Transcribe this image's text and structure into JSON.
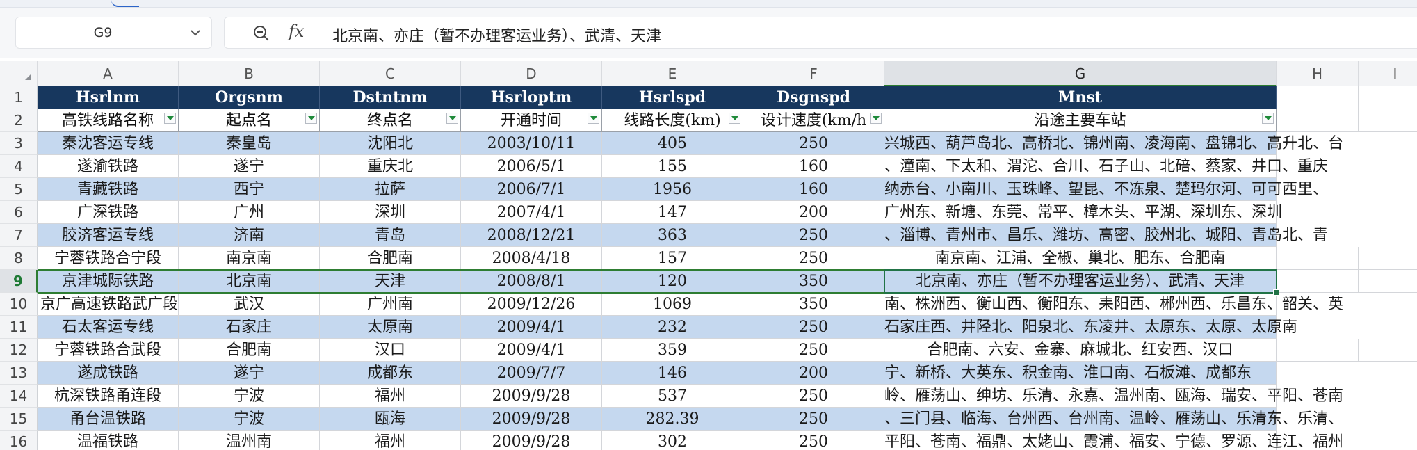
{
  "name_box": {
    "value": "G9"
  },
  "formula_bar": {
    "fx_label": "fx",
    "content": "北京南、亦庄（暂不办理客运业务）、武清、天津"
  },
  "columns": [
    "A",
    "B",
    "C",
    "D",
    "E",
    "F",
    "G",
    "H",
    "I"
  ],
  "selected_column": "G",
  "selected_row": "9",
  "header_row_1": [
    "Hsrlnm",
    "Orgsnm",
    "Dstntnm",
    "Hsrloptm",
    "Hsrlspd",
    "Dsgnspd",
    "Mnst"
  ],
  "header_row_2": [
    "高铁线路名称",
    "起点名",
    "终点名",
    "开通时间",
    "线路长度(km)",
    "设计速度(km/h",
    "沿途主要车站"
  ],
  "rows": [
    {
      "row": "3",
      "line": "秦沈客运专线",
      "start": "秦皇岛",
      "end": "沈阳北",
      "open": "2003/10/11",
      "length": "405",
      "speed": "250",
      "stations": "兴城西、葫芦岛北、高桥北、锦州南、凌海南、盘锦北、高升北、台"
    },
    {
      "row": "4",
      "line": "遂渝铁路",
      "start": "遂宁",
      "end": "重庆北",
      "open": "2006/5/1",
      "length": "155",
      "speed": "160",
      "stations": "、潼南、下太和、渭沱、合川、石子山、北碚、蔡家、井口、重庆"
    },
    {
      "row": "5",
      "line": "青藏铁路",
      "start": "西宁",
      "end": "拉萨",
      "open": "2006/7/1",
      "length": "1956",
      "speed": "160",
      "stations": "纳赤台、小南川、玉珠峰、望昆、不冻泉、楚玛尔河、可可西里、"
    },
    {
      "row": "6",
      "line": "广深铁路",
      "start": "广州",
      "end": "深圳",
      "open": "2007/4/1",
      "length": "147",
      "speed": "200",
      "stations": "广州东、新塘、东莞、常平、樟木头、平湖、深圳东、深圳"
    },
    {
      "row": "7",
      "line": "胶济客运专线",
      "start": "济南",
      "end": "青岛",
      "open": "2008/12/21",
      "length": "363",
      "speed": "250",
      "stations": "、淄博、青州市、昌乐、潍坊、高密、胶州北、城阳、青岛北、青"
    },
    {
      "row": "8",
      "line": "宁蓉铁路合宁段",
      "start": "南京南",
      "end": "合肥南",
      "open": "2008/4/18",
      "length": "157",
      "speed": "250",
      "stations": "南京南、江浦、全椒、巢北、肥东、合肥南"
    },
    {
      "row": "9",
      "line": "京津城际铁路",
      "start": "北京南",
      "end": "天津",
      "open": "2008/8/1",
      "length": "120",
      "speed": "350",
      "stations": "北京南、亦庄（暂不办理客运业务）、武清、天津"
    },
    {
      "row": "10",
      "line": "京广高速铁路武广段",
      "start": "武汉",
      "end": "广州南",
      "open": "2009/12/26",
      "length": "1069",
      "speed": "350",
      "stations": "南、株洲西、衡山西、衡阳东、耒阳西、郴州西、乐昌东、韶关、英"
    },
    {
      "row": "11",
      "line": "石太客运专线",
      "start": "石家庄",
      "end": "太原南",
      "open": "2009/4/1",
      "length": "232",
      "speed": "250",
      "stations": "石家庄西、井陉北、阳泉北、东凌井、太原东、太原、太原南"
    },
    {
      "row": "12",
      "line": "宁蓉铁路合武段",
      "start": "合肥南",
      "end": "汉口",
      "open": "2009/4/1",
      "length": "359",
      "speed": "250",
      "stations": "合肥南、六安、金寨、麻城北、红安西、汉口"
    },
    {
      "row": "13",
      "line": "遂成铁路",
      "start": "遂宁",
      "end": "成都东",
      "open": "2009/7/7",
      "length": "146",
      "speed": "200",
      "stations": "宁、新桥、大英东、积金南、淮口南、石板滩、成都东"
    },
    {
      "row": "14",
      "line": "杭深铁路甬连段",
      "start": "宁波",
      "end": "福州",
      "open": "2009/9/28",
      "length": "537",
      "speed": "250",
      "stations": "岭、雁荡山、绅坊、乐清、永嘉、温州南、瓯海、瑞安、平阳、苍南"
    },
    {
      "row": "15",
      "line": "甬台温铁路",
      "start": "宁波",
      "end": "瓯海",
      "open": "2009/9/28",
      "length": "282.39",
      "speed": "250",
      "stations": "、三门县、临海、台州西、台州南、温岭、雁荡山、乐清东、乐清、"
    },
    {
      "row": "16",
      "line": "温福铁路",
      "start": "温州南",
      "end": "福州",
      "open": "2009/9/28",
      "length": "302",
      "speed": "250",
      "stations": "平阳、苍南、福鼎、太姥山、霞浦、福安、宁德、罗源、连江、福州"
    }
  ],
  "colors": {
    "header_fill": "#17375e",
    "band_fill": "#c5d8ef",
    "selection": "#217346"
  }
}
